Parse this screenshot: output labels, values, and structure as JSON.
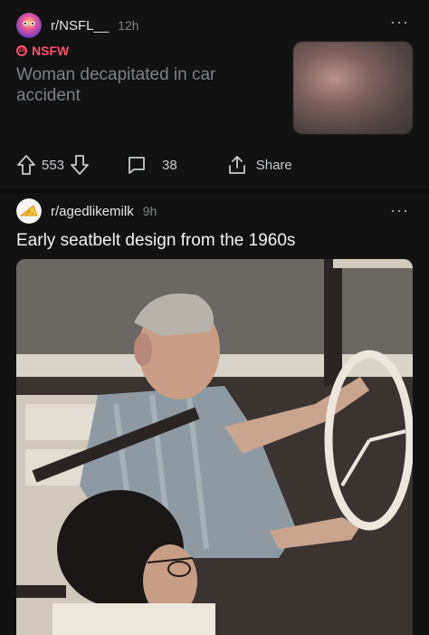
{
  "post1": {
    "subreddit": "r/NSFL__",
    "age": "12h",
    "nsfw_label": "NSFW",
    "title": "Woman decapitated in car accident",
    "upvotes": "553",
    "comments": "38",
    "share_label": "Share"
  },
  "post2": {
    "subreddit": "r/agedlikemilk",
    "age": "9h",
    "title": "Early seatbelt design from the 1960s"
  },
  "icons": [
    "upvote-icon",
    "downvote-icon",
    "comment-icon",
    "share-icon",
    "more-options-icon"
  ],
  "colors": {
    "background": "#121212",
    "nsfw": "#ff4f6a",
    "muted": "#818384"
  }
}
